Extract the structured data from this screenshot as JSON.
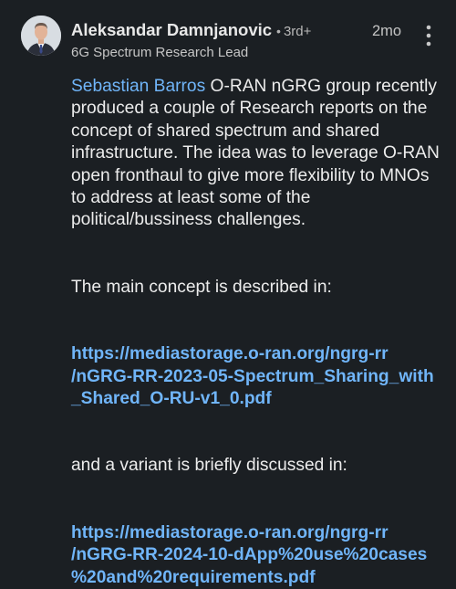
{
  "author": {
    "name": "Aleksandar Damnjanovic",
    "separator": "•",
    "degree": "3rd+",
    "headline": "6G Spectrum Research Lead",
    "avatar_icon": "person-avatar-icon"
  },
  "meta": {
    "time_ago": "2mo",
    "menu_icon": "more-vertical-icon"
  },
  "comment": {
    "mention": "Sebastian Barros",
    "intro_text": " O-RAN nGRG group recently produced a couple of Research reports on the concept of shared spectrum and shared infrastructure. The idea was to leverage O-RAN open fronthaul to give more flexibility to MNOs to address at least some of the political/bussiness challenges.",
    "main_concept_text": "The main concept is described in:",
    "link1_line1": "https://mediastorage.o-ran.org/ngrg-rr",
    "link1_line2": "/nGRG-RR-2023-05-Spectrum_Sharing_with",
    "link1_line3": "_Shared_O-RU-v1_0.pdf",
    "variant_text": "and a variant is briefly discussed in:",
    "link2_line1": "https://mediastorage.o-ran.org/ngrg-rr",
    "link2_line2": "/nGRG-RR-2024-10-dApp%20use%20cases",
    "link2_line3": "%20and%20requirements.pdf"
  },
  "colors": {
    "background": "#1b1f23",
    "link": "#70b5f9",
    "text": "#ececec"
  }
}
